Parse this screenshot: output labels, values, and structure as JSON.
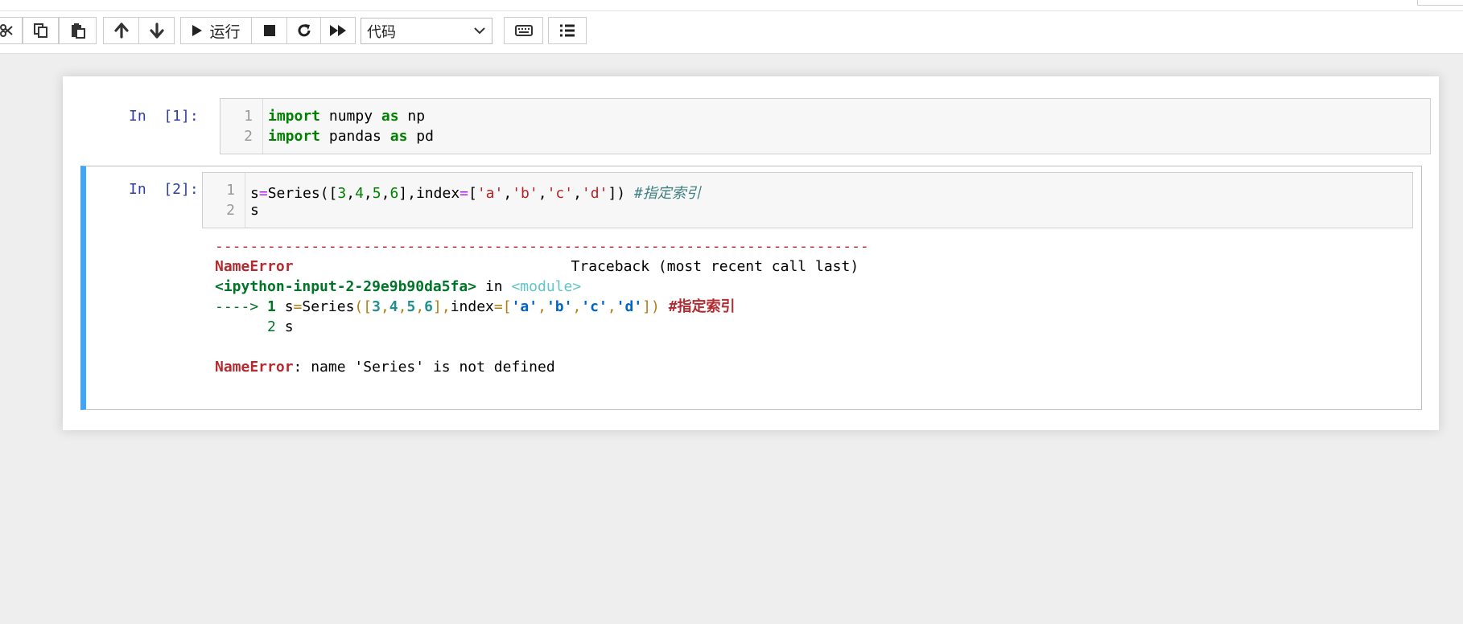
{
  "toolbar": {
    "run_label": "运行",
    "cell_type": "代码",
    "icons": [
      "cut-icon",
      "copy-icon",
      "paste-icon",
      "arrow-up-icon",
      "arrow-down-icon",
      "play-icon",
      "stop-icon",
      "restart-icon",
      "fast-forward-icon",
      "keyboard-icon",
      "list-icon"
    ]
  },
  "cells": [
    {
      "prompt": "In  [1]:",
      "lines": [
        {
          "n": "1"
        },
        {
          "n": "2"
        }
      ]
    },
    {
      "prompt": "In  [2]:",
      "lines": [
        {
          "n": "1"
        },
        {
          "n": "2"
        }
      ]
    }
  ],
  "code": {
    "c1l1_kw1": "import",
    "c1l1_mod": " numpy ",
    "c1l1_kw2": "as",
    "c1l1_alias": " np",
    "c1l2_kw1": "import",
    "c1l2_mod": " pandas ",
    "c1l2_kw2": "as",
    "c1l2_alias": " pd",
    "c2l1_name": "s",
    "c2l1_eq": "=",
    "c2l1_fn": "Series([",
    "c2l1_n1": "3",
    "c2l1_n2": "4",
    "c2l1_n3": "5",
    "c2l1_n4": "6",
    "c2l1_mid": "],index",
    "c2l1_eq2": "=",
    "c2l1_lb": "[",
    "c2l1_s1": "'a'",
    "c2l1_s2": "'b'",
    "c2l1_s3": "'c'",
    "c2l1_s4": "'d'",
    "c2l1_rb": "]) ",
    "c2l1_comment": "#指定索引",
    "c2l2": "s"
  },
  "error": {
    "separator": "---------------------------------------------------------------------------",
    "name": "NameError",
    "traceback_label": "Traceback (most recent call last)",
    "input_ref": "<ipython-input-2-29e9b90da5fa>",
    "in_word": " in ",
    "module": "<module>",
    "arrow": "---->",
    "line1_no": " 1 ",
    "line1_a": "s",
    "line1_eq": "=",
    "line1_fn": "Series",
    "line1_open": "([",
    "line1_n1": "3",
    "line1_n2": "4",
    "line1_n3": "5",
    "line1_n4": "6",
    "line1_mid1": "],",
    "line1_idx": "index",
    "line1_eq2": "=",
    "line1_lb": "[",
    "line1_s1": "'a'",
    "line1_s2": "'b'",
    "line1_s3": "'c'",
    "line1_s4": "'d'",
    "line1_rb": "])",
    "line1_comment": " #指定索引",
    "line2_no": "      2 ",
    "line2_code": "s",
    "message_name": "NameError",
    "message_text": ": name 'Series' is not defined",
    "comma": ","
  }
}
